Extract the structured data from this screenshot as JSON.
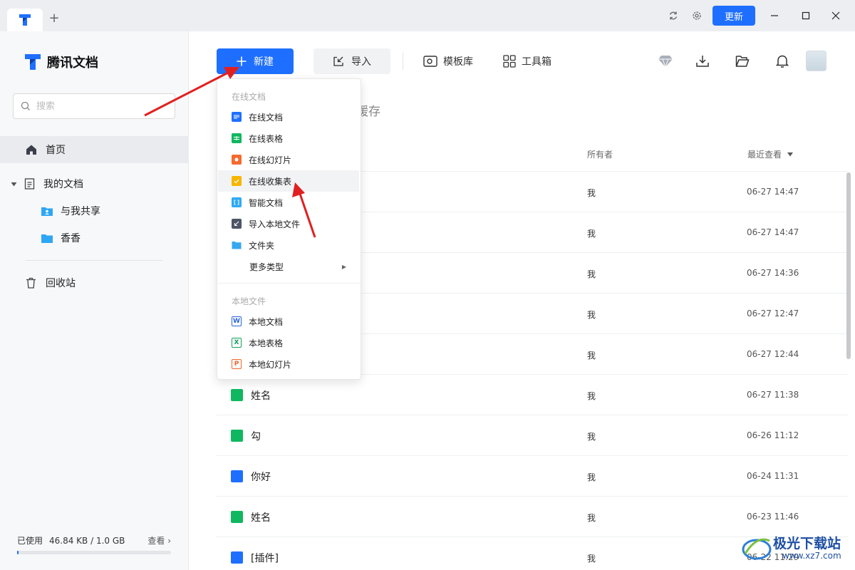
{
  "titlebar": {
    "update_label": "更新",
    "new_tab_symbol": "+"
  },
  "sidebar": {
    "brand": "腾讯文档",
    "search_placeholder": "搜索",
    "nav": {
      "home": "首页",
      "my_docs": "我的文档",
      "shared": "与我共享",
      "folder": "香香",
      "trash": "回收站"
    },
    "storage": {
      "used_label": "已使用",
      "used_value": "46.84 KB / 1.0 GB",
      "view_label": "查看 ›"
    }
  },
  "toolbar": {
    "new_label": "新建",
    "import_label": "导入",
    "templates_label": "模板库",
    "tools_label": "工具箱"
  },
  "section": {
    "tab_visible_fragment": "缓存"
  },
  "list": {
    "headers": {
      "owner": "所有者",
      "recent": "最近查看"
    },
    "rows": [
      {
        "name": "",
        "owner": "我",
        "time": "06-27 14:47",
        "type": "doc"
      },
      {
        "name": "",
        "owner": "我",
        "time": "06-27 14:47",
        "type": "doc"
      },
      {
        "name": "",
        "owner": "我",
        "time": "06-27 14:36",
        "type": "doc"
      },
      {
        "name": "",
        "owner": "我",
        "time": "06-27 12:47",
        "type": "doc"
      },
      {
        "name": "",
        "owner": "我",
        "time": "06-27 12:44",
        "type": "doc"
      },
      {
        "name": "姓名",
        "owner": "我",
        "time": "06-27 11:38",
        "type": "sheet"
      },
      {
        "name": "勾",
        "owner": "我",
        "time": "06-26 11:12",
        "type": "sheet"
      },
      {
        "name": "你好",
        "owner": "我",
        "time": "06-24 11:31",
        "type": "doc"
      },
      {
        "name": "姓名",
        "owner": "我",
        "time": "06-23 11:46",
        "type": "sheet"
      },
      {
        "name": "[插件]",
        "owner": "我",
        "time": "06-22 11:29",
        "type": "doc"
      }
    ]
  },
  "menu": {
    "online_section": "在线文档",
    "online_items": [
      {
        "label": "在线文档",
        "icon": "doc-icon",
        "color": "#1e6fff"
      },
      {
        "label": "在线表格",
        "icon": "sheet-icon",
        "color": "#10b760"
      },
      {
        "label": "在线幻灯片",
        "icon": "slide-icon",
        "color": "#f56a2f"
      },
      {
        "label": "在线收集表",
        "icon": "form-icon",
        "color": "#f7b500"
      },
      {
        "label": "智能文档",
        "icon": "smart-doc-icon",
        "color": "#2fa9f5"
      },
      {
        "label": "导入本地文件",
        "icon": "import-icon",
        "color": "#4d5566"
      },
      {
        "label": "文件夹",
        "icon": "folder-icon",
        "color": "#35a8f0"
      },
      {
        "label": "更多类型",
        "icon": "",
        "color": ""
      }
    ],
    "local_section": "本地文件",
    "local_items": [
      {
        "label": "本地文档",
        "icon": "word-icon",
        "color": "#2b66d6",
        "glyph": "W"
      },
      {
        "label": "本地表格",
        "icon": "excel-icon",
        "color": "#14a05a",
        "glyph": "X"
      },
      {
        "label": "本地幻灯片",
        "icon": "ppt-icon",
        "color": "#f0652b",
        "glyph": "P"
      }
    ]
  },
  "watermark": {
    "text": "极光下载站",
    "url": "www.xz7.com"
  },
  "colors": {
    "accent": "#1e6fff",
    "annotation_arrow": "#e02020"
  }
}
